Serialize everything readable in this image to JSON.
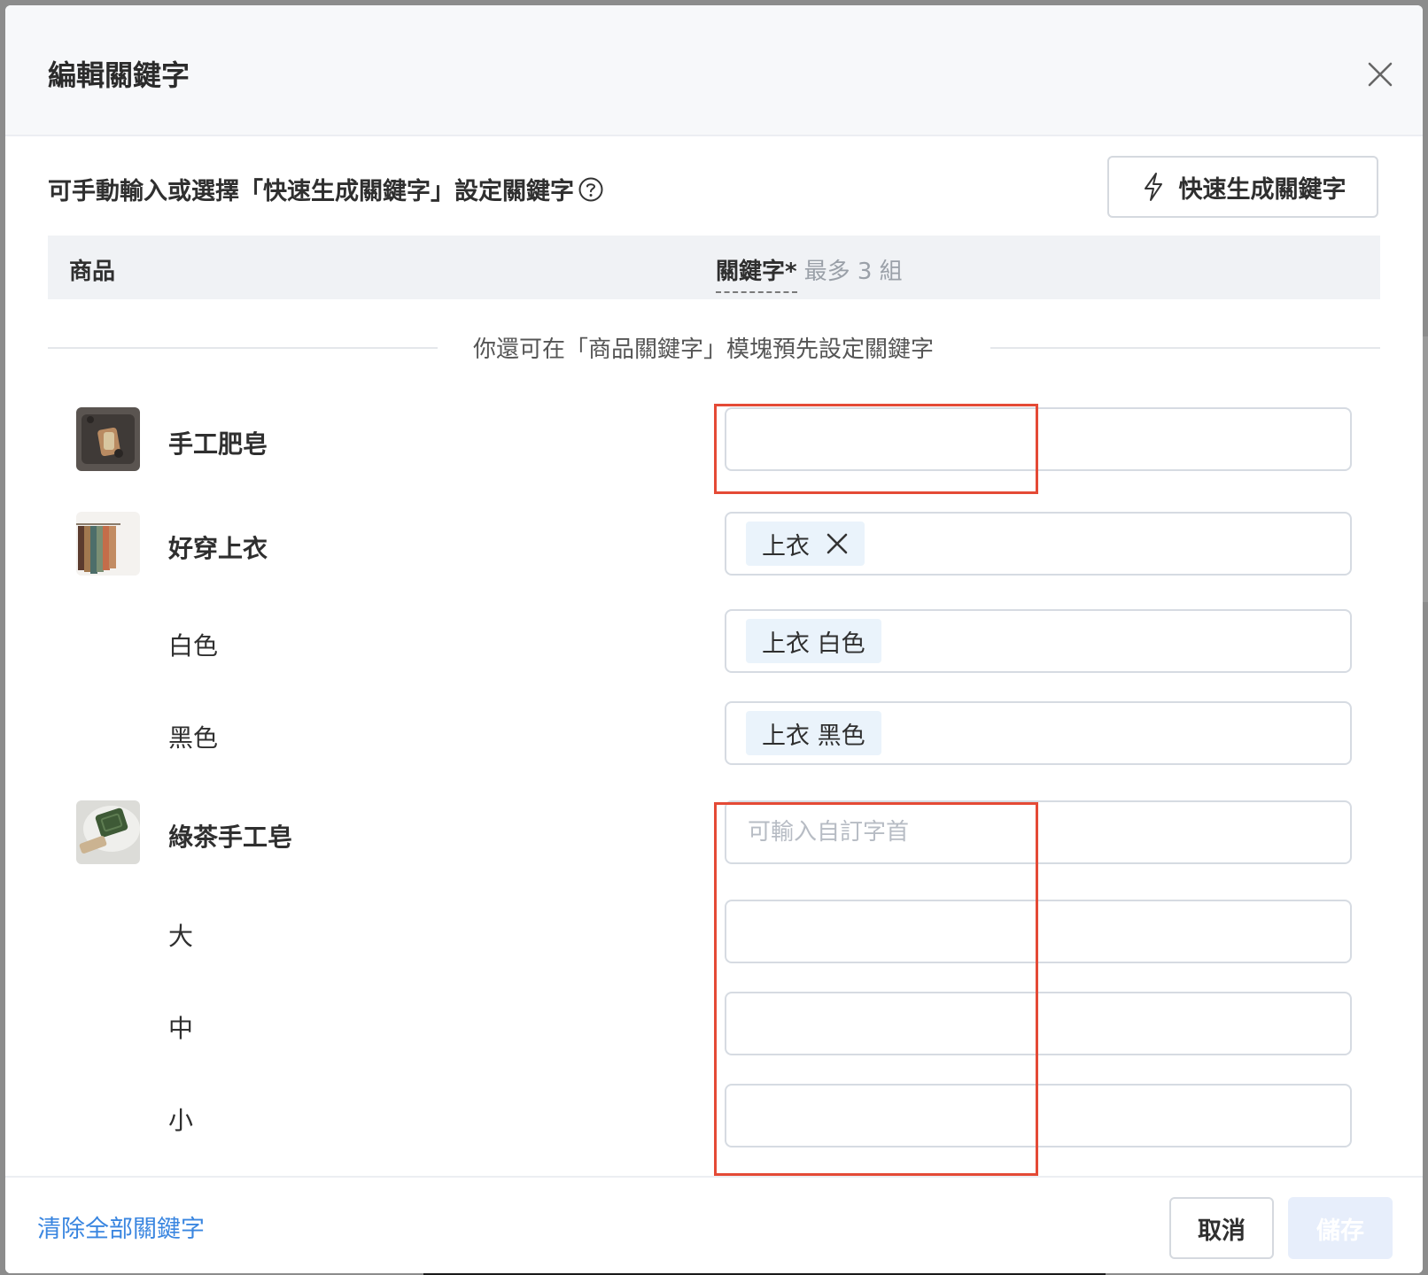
{
  "modal": {
    "title": "編輯關鍵字",
    "description": "可手動輸入或選擇「快速生成關鍵字」設定關鍵字",
    "quick_generate_label": "快速生成關鍵字"
  },
  "table": {
    "header_product": "商品",
    "header_keyword": "關鍵字*",
    "header_keyword_hint": "最多 3 組",
    "divider_text": "你還可在「商品關鍵字」模塊預先設定關鍵字"
  },
  "rows": {
    "soap": {
      "name": "手工肥皂",
      "keyword_value": ""
    },
    "shirt": {
      "name": "好穿上衣",
      "tag": "上衣"
    },
    "white": {
      "name": "白色",
      "tag": "上衣 白色"
    },
    "black": {
      "name": "黑色",
      "tag": "上衣 黑色"
    },
    "greentea": {
      "name": "綠茶手工皂",
      "placeholder": "可輸入自訂字首"
    },
    "large": {
      "name": "大",
      "keyword_value": ""
    },
    "medium": {
      "name": "中",
      "keyword_value": ""
    },
    "small": {
      "name": "小",
      "keyword_value": ""
    }
  },
  "footer": {
    "clear_all": "清除全部關鍵字",
    "cancel": "取消",
    "save": "儲存"
  },
  "colors": {
    "link": "#3a86e0",
    "tag_bg": "#eaf3fb",
    "highlight": "#e44a36",
    "save_disabled_bg": "#e7eefb"
  },
  "icons": {
    "close": "close-icon",
    "help": "help-circle-icon",
    "quick_generate": "lightning-icon",
    "tag_remove": "close-icon"
  }
}
